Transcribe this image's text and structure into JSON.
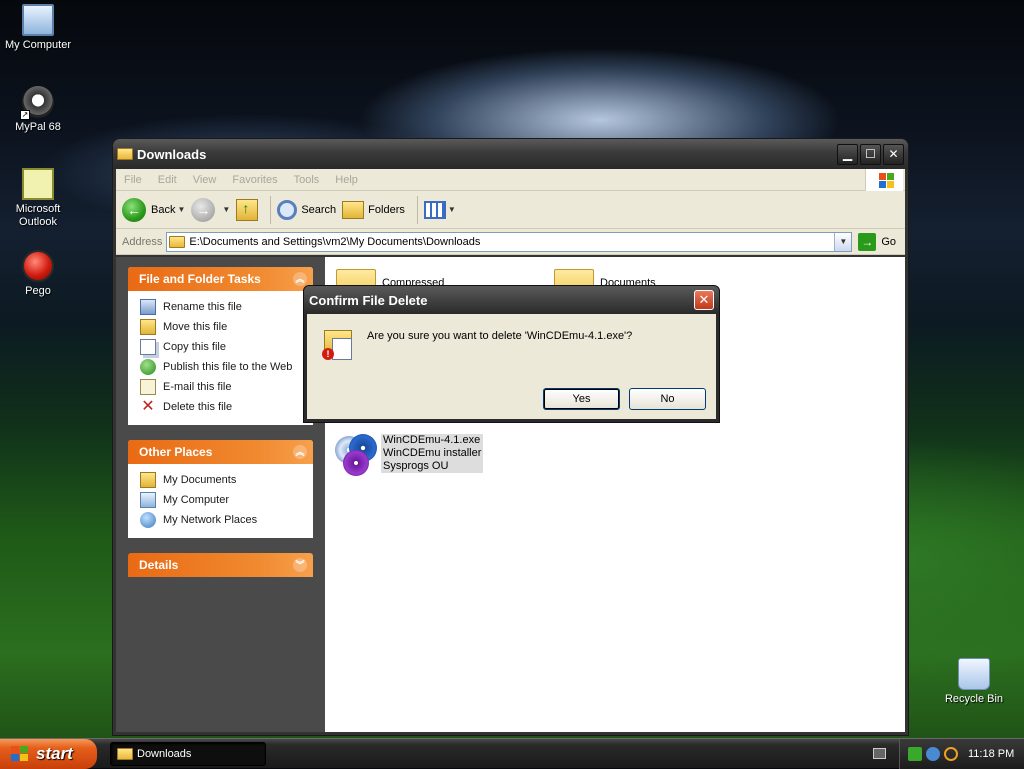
{
  "desktop": {
    "icons": [
      {
        "label": "My Computer",
        "icon": "my-computer-icon"
      },
      {
        "label": "MyPal 68",
        "icon": "mypal-browser-icon"
      },
      {
        "label": "Microsoft Outlook",
        "icon": "outlook-icon"
      },
      {
        "label": "Pego",
        "icon": "pego-icon"
      },
      {
        "label": "Recycle Bin",
        "icon": "recycle-bin-icon"
      }
    ]
  },
  "window": {
    "title": "Downloads",
    "menu": [
      "File",
      "Edit",
      "View",
      "Favorites",
      "Tools",
      "Help"
    ],
    "toolbar": {
      "back": "Back",
      "search": "Search",
      "folders": "Folders"
    },
    "address": {
      "label": "Address",
      "value": "E:\\Documents and Settings\\vm2\\My Documents\\Downloads",
      "go": "Go"
    },
    "tasks_panel": {
      "title": "File and Folder Tasks",
      "items": [
        {
          "label": "Rename this file",
          "icon": "rename-icon"
        },
        {
          "label": "Move this file",
          "icon": "move-icon"
        },
        {
          "label": "Copy this file",
          "icon": "copy-icon"
        },
        {
          "label": "Publish this file to the Web",
          "icon": "publish-icon"
        },
        {
          "label": "E-mail this file",
          "icon": "email-icon"
        },
        {
          "label": "Delete this file",
          "icon": "delete-icon"
        }
      ]
    },
    "other_places_panel": {
      "title": "Other Places",
      "items": [
        {
          "label": "My Documents",
          "icon": "my-documents-icon"
        },
        {
          "label": "My Computer",
          "icon": "my-computer-icon"
        },
        {
          "label": "My Network Places",
          "icon": "network-places-icon"
        }
      ]
    },
    "details_panel": {
      "title": "Details"
    },
    "files": {
      "folders": [
        "Compressed",
        "Documents"
      ],
      "selected_file": {
        "name": "WinCDEmu-4.1.exe",
        "description": "WinCDEmu installer",
        "company": "Sysprogs OU"
      }
    }
  },
  "dialog": {
    "title": "Confirm File Delete",
    "message": "Are you sure you want to delete 'WinCDEmu-4.1.exe'?",
    "yes": "Yes",
    "no": "No",
    "close": "✕"
  },
  "taskbar": {
    "start": "start",
    "task": "Downloads",
    "clock": "11:18 PM"
  }
}
